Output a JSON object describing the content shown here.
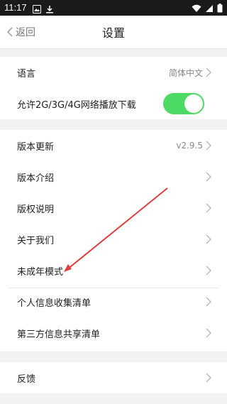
{
  "status": {
    "time": "11:17"
  },
  "header": {
    "back_label": "返回",
    "title": "设置"
  },
  "group1": {
    "language_label": "语言",
    "language_value": "简体中文",
    "network_label": "允许2G/3G/4G网络播放下载",
    "network_enabled": true
  },
  "group2": {
    "items": [
      {
        "label": "版本更新",
        "value": "v2.9.5"
      },
      {
        "label": "版本介绍"
      },
      {
        "label": "版权说明"
      },
      {
        "label": "关于我们"
      },
      {
        "label": "未成年模式"
      },
      {
        "label": "个人信息收集清单"
      },
      {
        "label": "第三方信息共享清单"
      }
    ]
  },
  "group3": {
    "feedback_label": "反馈"
  },
  "colors": {
    "toggle_on": "#4cd964",
    "annotation_arrow": "#e03b3b"
  }
}
